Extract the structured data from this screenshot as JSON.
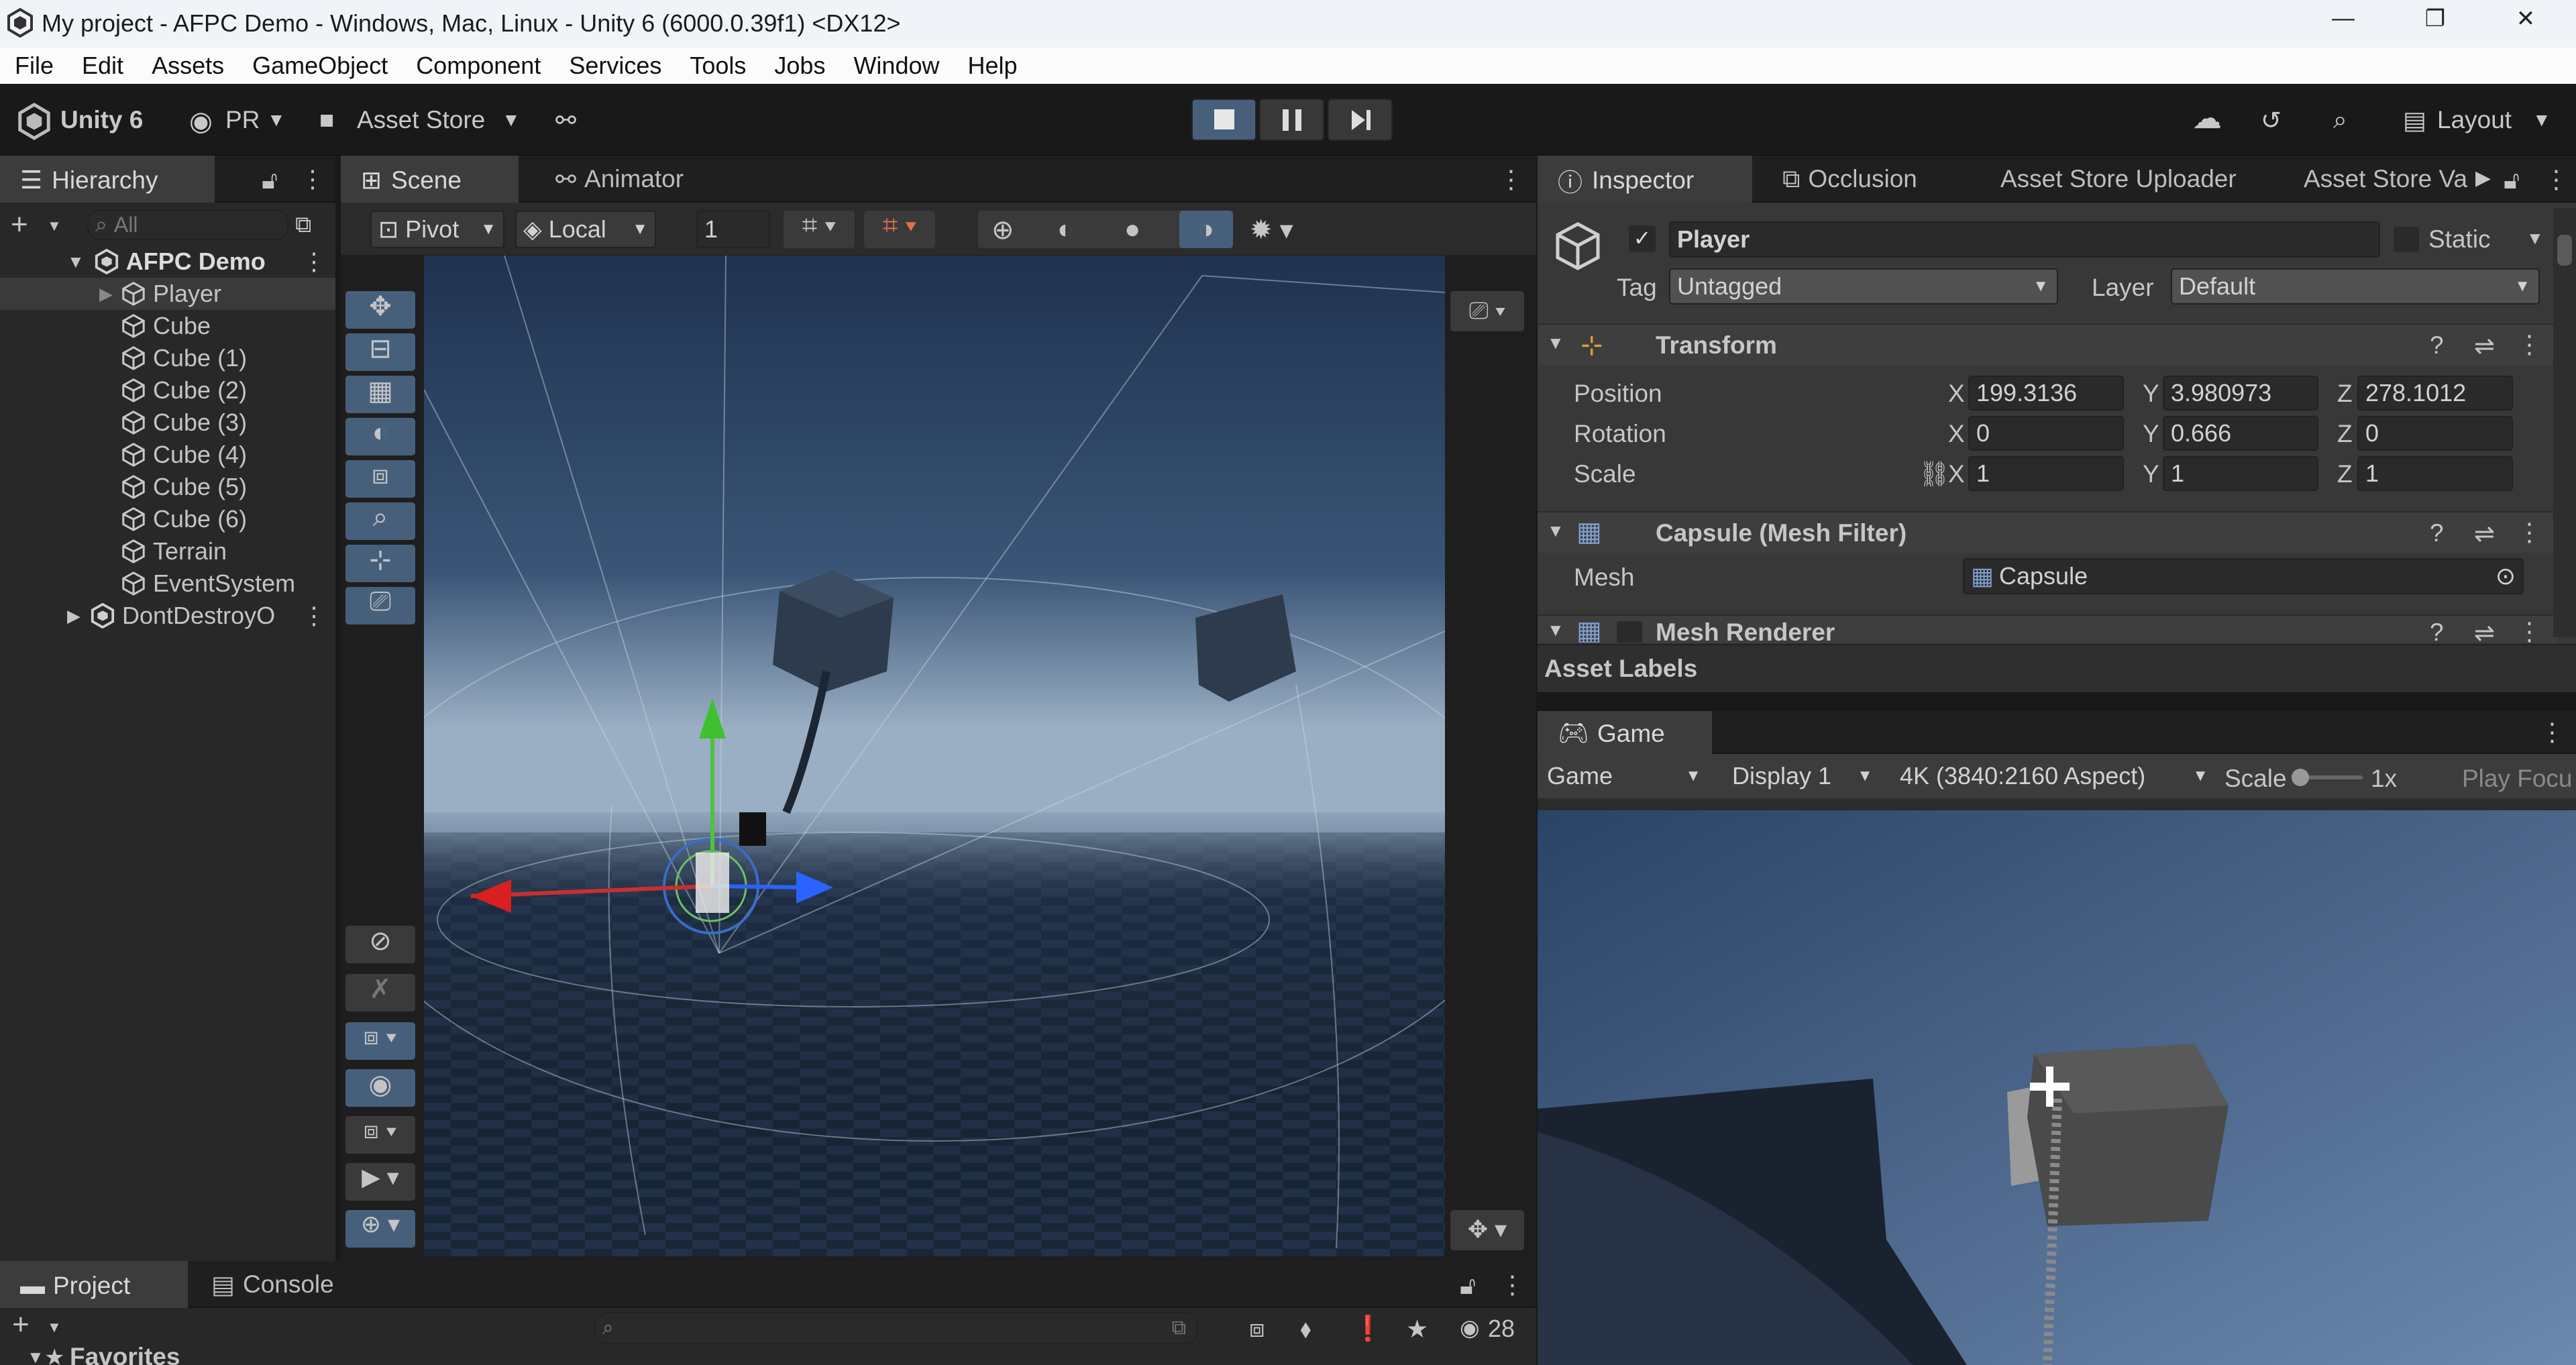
{
  "window": {
    "title": "My project - AFPC Demo - Windows, Mac, Linux - Unity 6 (6000.0.39f1) <DX12>",
    "minimize": "—",
    "restore": "❐",
    "close": "✕"
  },
  "menu": [
    "File",
    "Edit",
    "Assets",
    "GameObject",
    "Component",
    "Services",
    "Tools",
    "Jobs",
    "Window",
    "Help"
  ],
  "toolbar": {
    "brand": "Unity 6",
    "account": "PR",
    "asset_store": "Asset Store",
    "layout": "Layout"
  },
  "hierarchy": {
    "tab": "Hierarchy",
    "search_placeholder": "All",
    "scene": "AFPC Demo",
    "items": [
      "Player",
      "Cube",
      "Cube (1)",
      "Cube (2)",
      "Cube (3)",
      "Cube (4)",
      "Cube (5)",
      "Cube (6)",
      "Terrain",
      "EventSystem"
    ],
    "dont_destroy": "DontDestroyO"
  },
  "scene": {
    "tabs": [
      "Scene",
      "Animator"
    ],
    "pivot": "Pivot",
    "local": "Local",
    "grid_value": "1"
  },
  "inspector": {
    "tabs": [
      "Inspector",
      "Occlusion",
      "Asset Store Uploader",
      "Asset Store Va"
    ],
    "object_name": "Player",
    "static_label": "Static",
    "tag_label": "Tag",
    "tag_value": "Untagged",
    "layer_label": "Layer",
    "layer_value": "Default",
    "transform": {
      "title": "Transform",
      "position_label": "Position",
      "rotation_label": "Rotation",
      "scale_label": "Scale",
      "axis_x": "X",
      "axis_y": "Y",
      "axis_z": "Z",
      "position": [
        "199.3136",
        "3.980973",
        "278.1012"
      ],
      "rotation": [
        "0",
        "0.666",
        "0"
      ],
      "scale": [
        "1",
        "1",
        "1"
      ]
    },
    "mesh_filter": {
      "title": "Capsule (Mesh Filter)",
      "mesh_label": "Mesh",
      "mesh_value": "Capsule"
    },
    "mesh_renderer": {
      "title": "Mesh Renderer"
    },
    "asset_labels": "Asset Labels"
  },
  "game": {
    "tab": "Game",
    "mode": "Game",
    "display": "Display 1",
    "resolution": "4K (3840:2160 Aspect)",
    "scale_label": "Scale",
    "scale_value": "1x",
    "play_focus": "Play Focu"
  },
  "bottom": {
    "tabs": [
      "Project",
      "Console"
    ],
    "favorites": "Favorites",
    "count": "28"
  },
  "colors": {
    "accent_blue": "#46607c",
    "panel": "#383838",
    "sky_top": "#2b4467",
    "sky_horizon": "#8ea4bb"
  }
}
